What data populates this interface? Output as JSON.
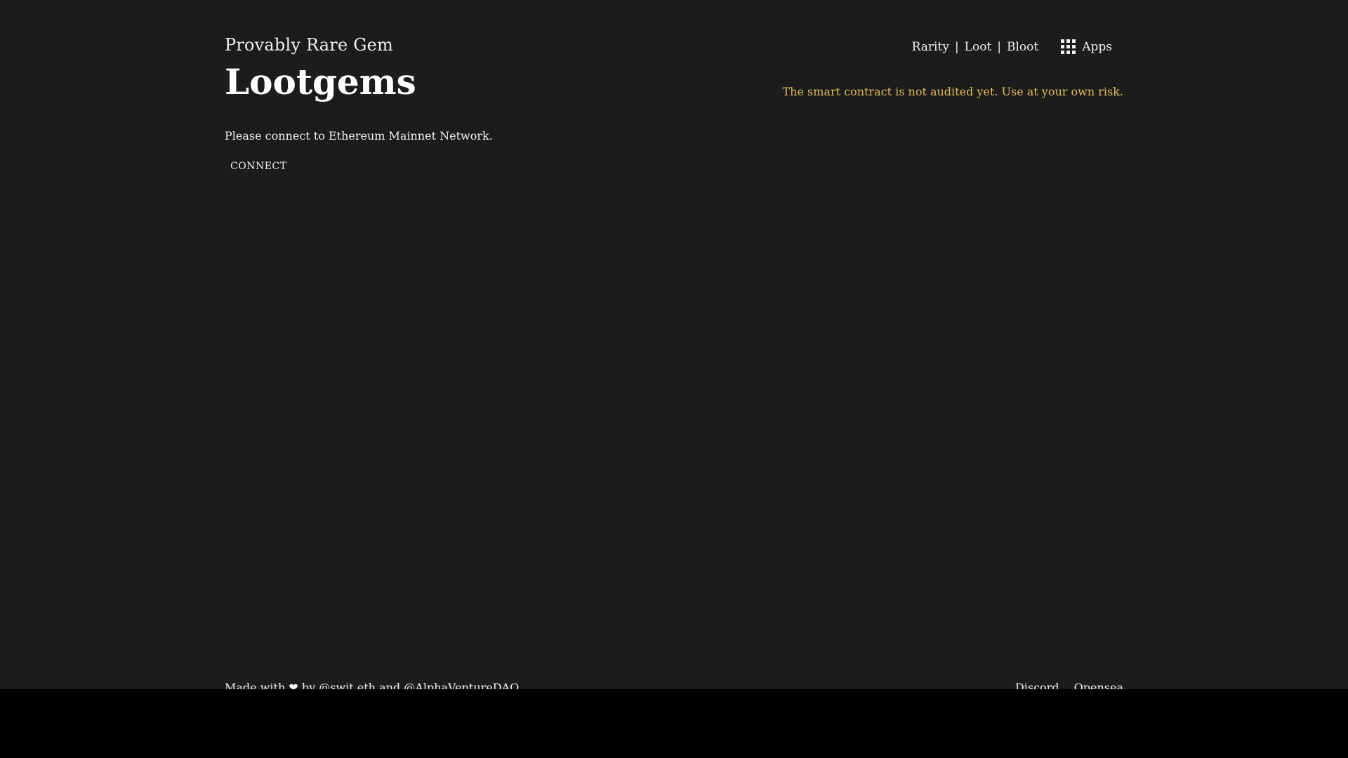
{
  "header": {
    "subtitle": "Provably Rare Gem",
    "title": "Lootgems"
  },
  "nav": {
    "links": [
      "Rarity",
      "Loot",
      "Bloot"
    ],
    "separator": "|",
    "apps_label": "Apps",
    "apps_icon": "grid-icon"
  },
  "warning": {
    "text": "The smart contract is not audited yet. Use at your own risk.",
    "color": "#e0bc58"
  },
  "main": {
    "prompt": "Please connect to Ethereum Mainnet Network.",
    "connect_label": "CONNECT"
  },
  "footer": {
    "made_with": "Made with",
    "heart_icon": "heart-icon",
    "by": "by",
    "author1": "@swit.eth",
    "and": "and",
    "author2": "@AlphaVentureDAO",
    "links": [
      "Discord",
      "Opensea"
    ]
  },
  "colors": {
    "background": "#1c1c1c",
    "text": "#f1f1f1",
    "accent": "#e0bc58"
  }
}
